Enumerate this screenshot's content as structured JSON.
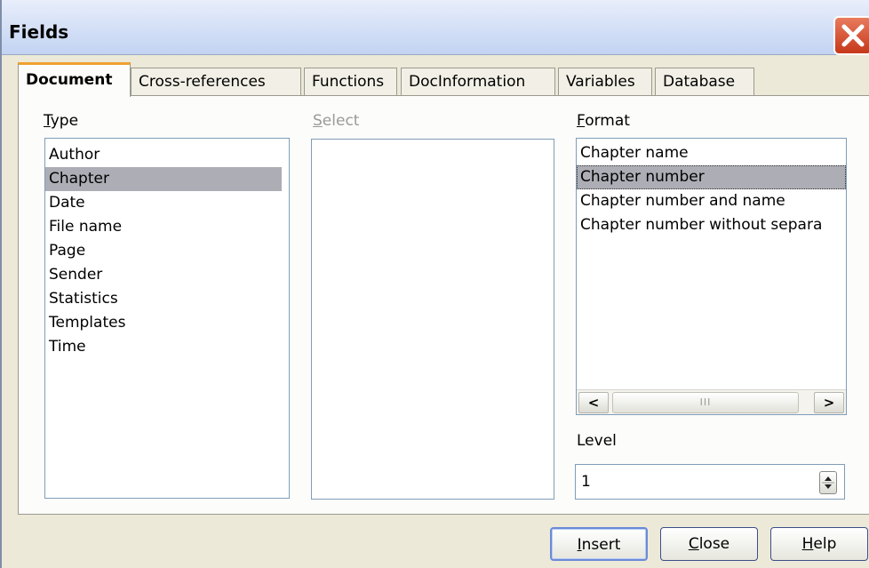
{
  "window": {
    "title": "Fields"
  },
  "tabs": [
    {
      "label": "Document",
      "active": true
    },
    {
      "label": "Cross-references",
      "active": false
    },
    {
      "label": "Functions",
      "active": false
    },
    {
      "label": "DocInformation",
      "active": false
    },
    {
      "label": "Variables",
      "active": false
    },
    {
      "label": "Database",
      "active": false
    }
  ],
  "type_section": {
    "label_first": "T",
    "label_rest": "ype",
    "items": [
      "Author",
      "Chapter",
      "Date",
      "File name",
      "Page",
      "Sender",
      "Statistics",
      "Templates",
      "Time"
    ],
    "selected": "Chapter"
  },
  "select_section": {
    "label_first": "S",
    "label_rest": "elect",
    "items": []
  },
  "format_section": {
    "label_first": "F",
    "label_rest": "ormat",
    "items": [
      "Chapter name",
      "Chapter number",
      "Chapter number and name",
      "Chapter number without separa"
    ],
    "selected": "Chapter number",
    "scroll_left_glyph": "<",
    "scroll_right_glyph": ">",
    "thumb_grip": "III"
  },
  "level": {
    "label": "Level",
    "value": "1"
  },
  "buttons": {
    "insert": {
      "first": "I",
      "rest": "nsert"
    },
    "close": {
      "first": "C",
      "rest": "lose"
    },
    "help": {
      "first": "H",
      "rest": "elp"
    }
  }
}
